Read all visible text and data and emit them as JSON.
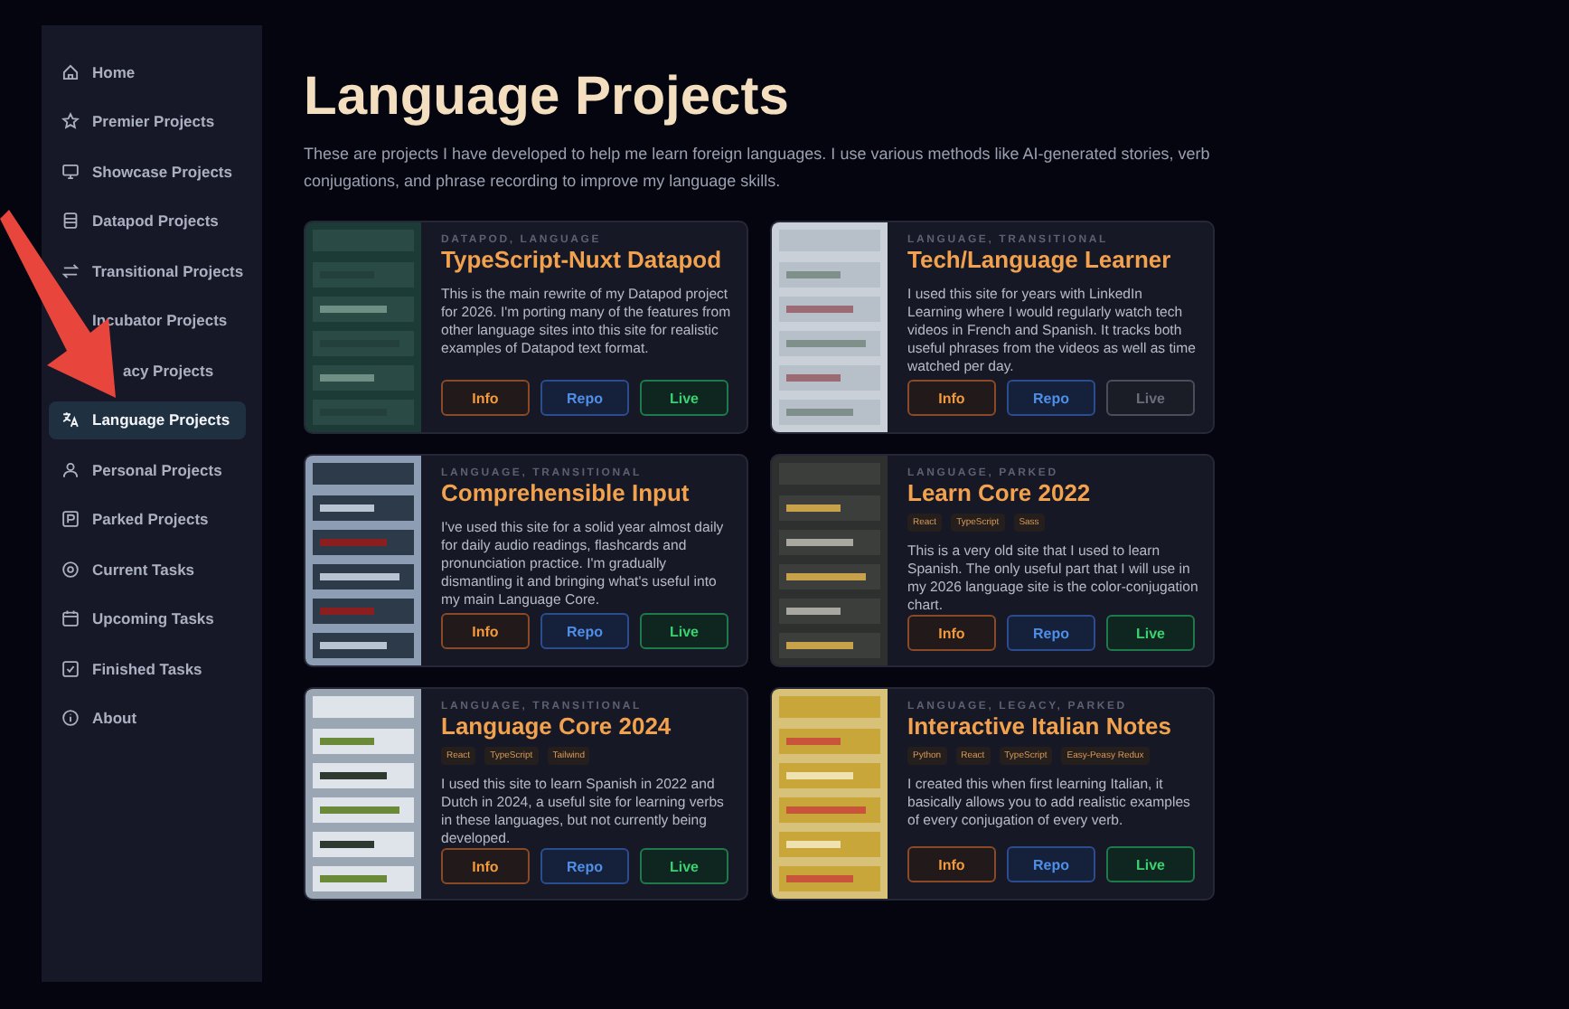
{
  "sidebar": {
    "items": [
      {
        "label": "Home",
        "selected": false
      },
      {
        "label": "Premier Projects",
        "selected": false
      },
      {
        "label": "Showcase Projects",
        "selected": false
      },
      {
        "label": "Datapod Projects",
        "selected": false
      },
      {
        "label": "Transitional Projects",
        "selected": false
      },
      {
        "label": "Incubator Projects",
        "selected": false
      },
      {
        "label": "acy Projects",
        "selected": false,
        "covered": true
      },
      {
        "label": "Language Projects",
        "selected": true
      },
      {
        "label": "Personal Projects",
        "selected": false
      },
      {
        "label": "Parked Projects",
        "selected": false
      },
      {
        "label": "Current Tasks",
        "selected": false
      },
      {
        "label": "Upcoming Tasks",
        "selected": false
      },
      {
        "label": "Finished Tasks",
        "selected": false
      },
      {
        "label": "About",
        "selected": false
      }
    ]
  },
  "page": {
    "title": "Language Projects",
    "description": "These are projects I have developed to help me learn foreign languages. I use various methods like AI-generated stories, verb conjugations, and phrase recording to improve my language skills."
  },
  "projects": [
    {
      "category": "DATAPOD, LANGUAGE",
      "title": "TypeScript-Nuxt Datapod",
      "description": "This is the main rewrite of my Datapod project for 2026. I'm porting many of the features from other language sites into this site for realistic examples of Datapod text format.",
      "buttons": [
        {
          "label": "Info",
          "kind": "info",
          "disabled": false
        },
        {
          "label": "Repo",
          "kind": "repo",
          "disabled": false
        },
        {
          "label": "Live",
          "kind": "live",
          "disabled": false
        }
      ]
    },
    {
      "category": "LANGUAGE, TRANSITIONAL",
      "title": "Tech/Language Learner",
      "description": "I used this site for years with LinkedIn Learning where I would regularly watch tech videos in French and Spanish. It tracks both useful phrases from the videos as well as time watched per day.",
      "buttons": [
        {
          "label": "Info",
          "kind": "info",
          "disabled": false
        },
        {
          "label": "Repo",
          "kind": "repo",
          "disabled": false
        },
        {
          "label": "Live",
          "kind": "live",
          "disabled": true
        }
      ]
    },
    {
      "category": "LANGUAGE, TRANSITIONAL",
      "title": "Comprehensible Input",
      "description": "I've used this site for a solid year almost daily for daily audio readings, flashcards and pronunciation practice. I'm gradually dismantling it and bringing what's useful into my main Language Core.",
      "buttons": [
        {
          "label": "Info",
          "kind": "info",
          "disabled": false
        },
        {
          "label": "Repo",
          "kind": "repo",
          "disabled": false
        },
        {
          "label": "Live",
          "kind": "live",
          "disabled": false
        }
      ]
    },
    {
      "category": "LANGUAGE, PARKED",
      "title": "Learn Core 2022",
      "tags": [
        "React",
        "TypeScript",
        "Sass"
      ],
      "description": "This is a very old site that I used to learn Spanish. The only useful part that I will use in my 2026 language site is the color-conjugation chart.",
      "buttons": [
        {
          "label": "Info",
          "kind": "info",
          "disabled": false
        },
        {
          "label": "Repo",
          "kind": "repo",
          "disabled": false
        },
        {
          "label": "Live",
          "kind": "live",
          "disabled": false
        }
      ]
    },
    {
      "category": "LANGUAGE, TRANSITIONAL",
      "title": "Language Core 2024",
      "tags": [
        "React",
        "TypeScript",
        "Tailwind"
      ],
      "description": "I used this site to learn Spanish in 2022 and Dutch in 2024, a useful site for learning verbs in these languages, but not currently being developed.",
      "buttons": [
        {
          "label": "Info",
          "kind": "info",
          "disabled": false
        },
        {
          "label": "Repo",
          "kind": "repo",
          "disabled": false
        },
        {
          "label": "Live",
          "kind": "live",
          "disabled": false
        }
      ]
    },
    {
      "category": "LANGUAGE, LEGACY, PARKED",
      "title": "Interactive Italian Notes",
      "tags": [
        "Python",
        "React",
        "TypeScript",
        "Easy-Peasy Redux"
      ],
      "description": "I created this when first learning Italian, it basically allows you to add realistic examples of every conjugation of every verb.",
      "buttons": [
        {
          "label": "Info",
          "kind": "info",
          "disabled": false
        },
        {
          "label": "Repo",
          "kind": "repo",
          "disabled": false
        },
        {
          "label": "Live",
          "kind": "live",
          "disabled": false
        }
      ]
    }
  ]
}
